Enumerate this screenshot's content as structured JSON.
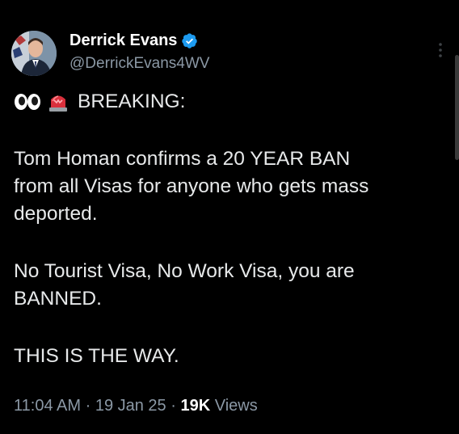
{
  "author": {
    "display_name": "Derrick Evans",
    "handle": "@DerrickEvans4WV",
    "verified": true,
    "avatar_icon": "profile-photo"
  },
  "post": {
    "emoji_icons": [
      "eyes-emoji",
      "police-light-emoji"
    ],
    "headline": "BREAKING:",
    "paragraphs": [
      [
        "Tom Homan confirms a 20 YEAR BAN",
        "from all Visas for anyone who gets mass",
        "deported."
      ],
      [
        "No Tourist Visa, No Work Visa, you are",
        "BANNED."
      ],
      [
        "THIS IS THE WAY."
      ]
    ]
  },
  "meta": {
    "time": "11:04 AM",
    "separator": "·",
    "date": "19 Jan 25",
    "views_count": "19K",
    "views_label": "Views"
  },
  "colors": {
    "background": "#000000",
    "text": "#e7e9ea",
    "secondary": "#8b98a5",
    "verified_badge": "#1d9bf0"
  }
}
